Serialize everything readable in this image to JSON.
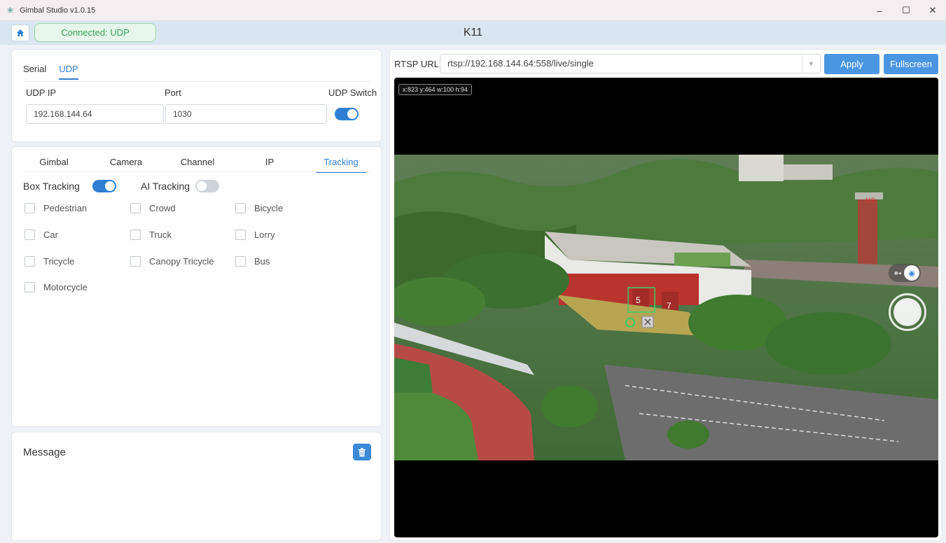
{
  "window": {
    "title": "Gimbal Studio v1.0.15",
    "minimize": "–",
    "maximize": "☐",
    "close": "✕"
  },
  "header": {
    "connection_status": "Connected: UDP",
    "device_name": "K11",
    "home_icon": "home-icon"
  },
  "connection": {
    "tabs": [
      {
        "label": "Serial",
        "active": false
      },
      {
        "label": "UDP",
        "active": true
      }
    ],
    "udp_ip_label": "UDP IP",
    "udp_ip_value": "192.168.144.64",
    "port_label": "Port",
    "port_value": "1030",
    "udp_switch_label": "UDP Switch",
    "udp_switch_on": true
  },
  "control": {
    "tabs": [
      {
        "label": "Gimbal",
        "active": false
      },
      {
        "label": "Camera",
        "active": false
      },
      {
        "label": "Channel",
        "active": false
      },
      {
        "label": "IP",
        "active": false
      },
      {
        "label": "Tracking",
        "active": true
      }
    ],
    "box_tracking_label": "Box Tracking",
    "box_tracking_on": true,
    "ai_tracking_label": "AI Tracking",
    "ai_tracking_on": false,
    "targets": [
      {
        "label": "Pedestrian",
        "checked": false
      },
      {
        "label": "Crowd",
        "checked": false
      },
      {
        "label": "Bicycle",
        "checked": false
      },
      {
        "label": "Car",
        "checked": false
      },
      {
        "label": "Truck",
        "checked": false
      },
      {
        "label": "Lorry",
        "checked": false
      },
      {
        "label": "Tricycle",
        "checked": false
      },
      {
        "label": "Canopy Tricycle",
        "checked": false
      },
      {
        "label": "Bus",
        "checked": false
      },
      {
        "label": "Motorcycle",
        "checked": false
      }
    ]
  },
  "message": {
    "title": "Message",
    "clear_icon": "trash-icon"
  },
  "video": {
    "rtsp_label": "RTSP URL:",
    "rtsp_url": "rtsp://192.168.144.64:558/live/single",
    "apply_label": "Apply",
    "fullscreen_label": "Fullscreen",
    "coord_readout": "x:823 y:464 w:100 h:94",
    "bay_numbers": [
      "5",
      "7"
    ],
    "tower_label": "119"
  },
  "colors": {
    "accent": "#2e7fd4",
    "connected_green": "#3aa35a",
    "tracking_box": "#38d06a"
  }
}
